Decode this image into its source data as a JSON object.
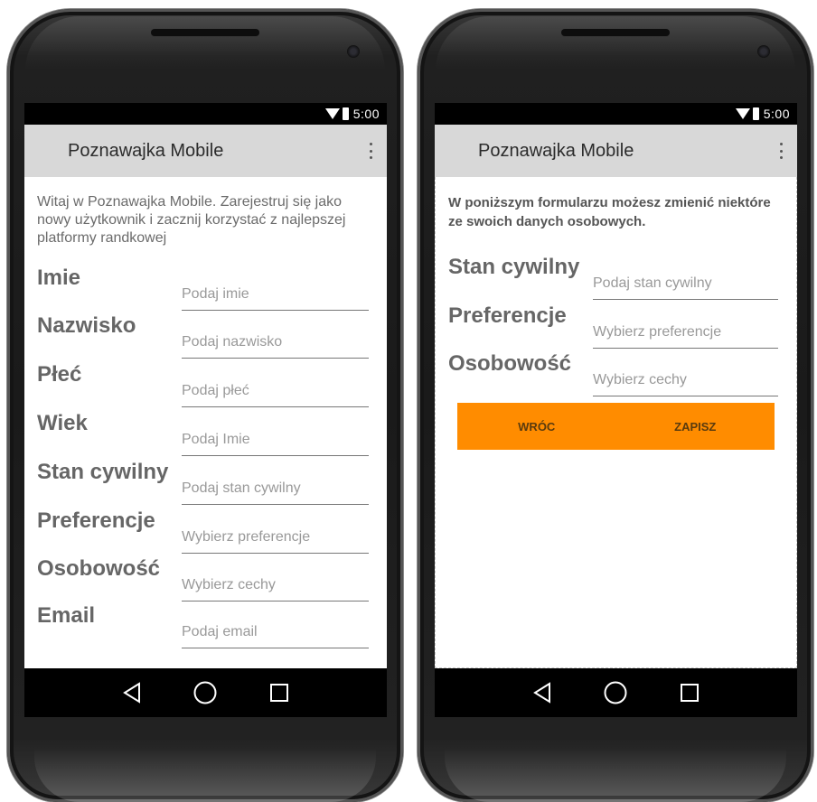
{
  "status_bar": {
    "time": "5:00"
  },
  "app": {
    "title": "Poznawajka Mobile"
  },
  "register_screen": {
    "intro": "Witaj w Poznawajka Mobile. Zarejestruj się jako nowy użytkownik i zacznij korzystać z najlepszej platformy randkowej",
    "fields": [
      {
        "label": "Imie",
        "placeholder": "Podaj imie"
      },
      {
        "label": "Nazwisko",
        "placeholder": "Podaj nazwisko"
      },
      {
        "label": "Płeć",
        "placeholder": "Podaj płeć"
      },
      {
        "label": "Wiek",
        "placeholder": "Podaj Imie"
      },
      {
        "label": "Stan cywilny",
        "placeholder": "Podaj stan cywilny"
      },
      {
        "label": "Preferencje",
        "placeholder": "Wybierz preferencje"
      },
      {
        "label": "Osobowość",
        "placeholder": "Wybierz cechy"
      },
      {
        "label": "Email",
        "placeholder": "Podaj email"
      }
    ]
  },
  "edit_screen": {
    "intro": "W poniższym formularzu możesz zmienić niektóre ze swoich danych osobowych.",
    "fields": [
      {
        "label": "Stan cywilny",
        "placeholder": "Podaj stan cywilny"
      },
      {
        "label": "Preferencje",
        "placeholder": "Wybierz preferencje"
      },
      {
        "label": "Osobowość",
        "placeholder": "Wybierz cechy"
      }
    ],
    "buttons": {
      "back": "WRÓC",
      "save": "ZAPISZ"
    }
  },
  "colors": {
    "accent": "#ff8c00",
    "app_bar": "#d8d8d8",
    "label": "#666666",
    "hint": "#999999"
  },
  "icons": {
    "status": [
      "wifi-icon",
      "battery-icon"
    ],
    "app_bar": "overflow-menu-icon",
    "nav": [
      "back-icon",
      "home-icon",
      "recents-icon"
    ]
  }
}
